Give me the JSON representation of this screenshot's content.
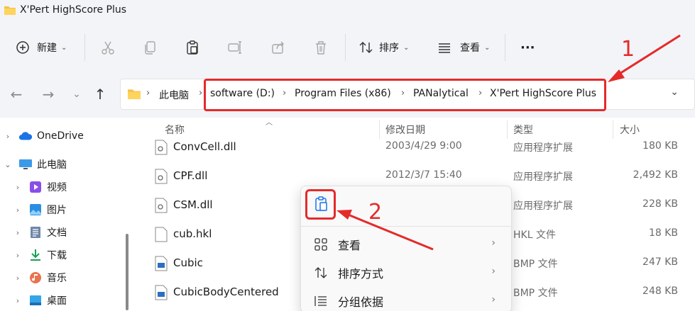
{
  "window": {
    "title": "X'Pert HighScore Plus"
  },
  "toolbar": {
    "new_label": "新建",
    "sort_label": "排序",
    "view_label": "查看",
    "more_label": "···"
  },
  "address": {
    "crumbs": [
      "此电脑",
      "software (D:)",
      "Program Files (x86)",
      "PANalytical",
      "X'Pert HighScore Plus"
    ]
  },
  "sidebar": {
    "items": [
      {
        "label": "OneDrive"
      },
      {
        "label": "此电脑"
      },
      {
        "label": "视频"
      },
      {
        "label": "图片"
      },
      {
        "label": "文档"
      },
      {
        "label": "下载"
      },
      {
        "label": "音乐"
      },
      {
        "label": "桌面"
      }
    ]
  },
  "columns": {
    "name": "名称",
    "date": "修改日期",
    "type": "类型",
    "size": "大小"
  },
  "files": [
    {
      "name": "ConvCell.dll",
      "date": "2003/4/29 9:00",
      "type": "应用程序扩展",
      "size": "180 KB"
    },
    {
      "name": "CPF.dll",
      "date": "2012/3/7 15:40",
      "type": "应用程序扩展",
      "size": "2,492 KB"
    },
    {
      "name": "CSM.dll",
      "date": "",
      "type": "应用程序扩展",
      "size": "228 KB"
    },
    {
      "name": "cub.hkl",
      "date": "",
      "type": "HKL 文件",
      "size": "18 KB"
    },
    {
      "name": "Cubic",
      "date": "",
      "type": "BMP 文件",
      "size": "247 KB"
    },
    {
      "name": "CubicBodyCentered",
      "date": "",
      "type": "BMP 文件",
      "size": "248 KB"
    }
  ],
  "context_menu": {
    "items": [
      {
        "label": "查看"
      },
      {
        "label": "排序方式"
      },
      {
        "label": "分组依据"
      }
    ]
  },
  "annotations": {
    "one": "1",
    "two": "2",
    "color": "#e52a2a"
  }
}
